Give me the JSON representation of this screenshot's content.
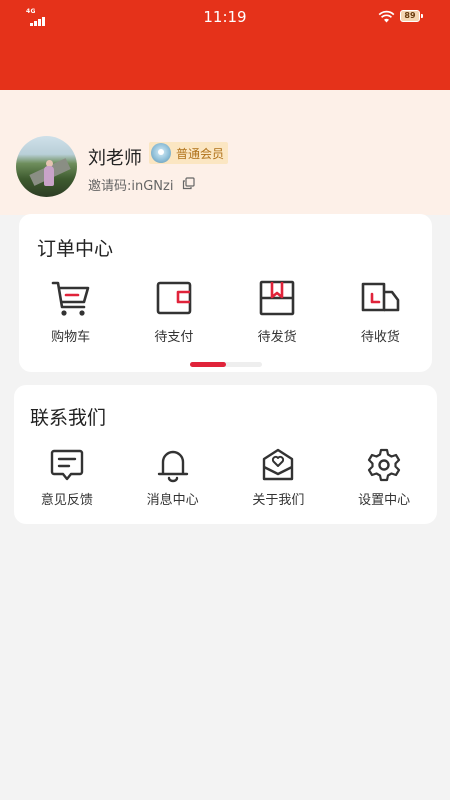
{
  "status_bar": {
    "time": "11:19",
    "network": "4G",
    "battery": "89",
    "icons": [
      "signal-icon",
      "wifi-icon",
      "battery-icon"
    ]
  },
  "profile": {
    "name": "刘老师",
    "member_level": "普通会员",
    "invite_code": "邀请码:inGNzi",
    "avatar_icon": "avatar-photo",
    "copy_icon": "copy-icon"
  },
  "orders": {
    "title": "订单中心",
    "items": [
      {
        "label": "购物车",
        "icon": "cart-icon"
      },
      {
        "label": "待支付",
        "icon": "wallet-icon"
      },
      {
        "label": "待发货",
        "icon": "box-icon"
      },
      {
        "label": "待收货",
        "icon": "truck-icon"
      }
    ],
    "pager_progress": 0.5
  },
  "contact": {
    "title": "联系我们",
    "items": [
      {
        "label": "意见反馈",
        "icon": "feedback-icon"
      },
      {
        "label": "消息中心",
        "icon": "bell-icon"
      },
      {
        "label": "关于我们",
        "icon": "heart-envelope-icon"
      },
      {
        "label": "设置中心",
        "icon": "gear-icon"
      }
    ]
  },
  "colors": {
    "header": "#e5321a",
    "accent": "#e0233a",
    "profile_bg": "#fdf0e8",
    "page_bg": "#f3f3f3"
  }
}
